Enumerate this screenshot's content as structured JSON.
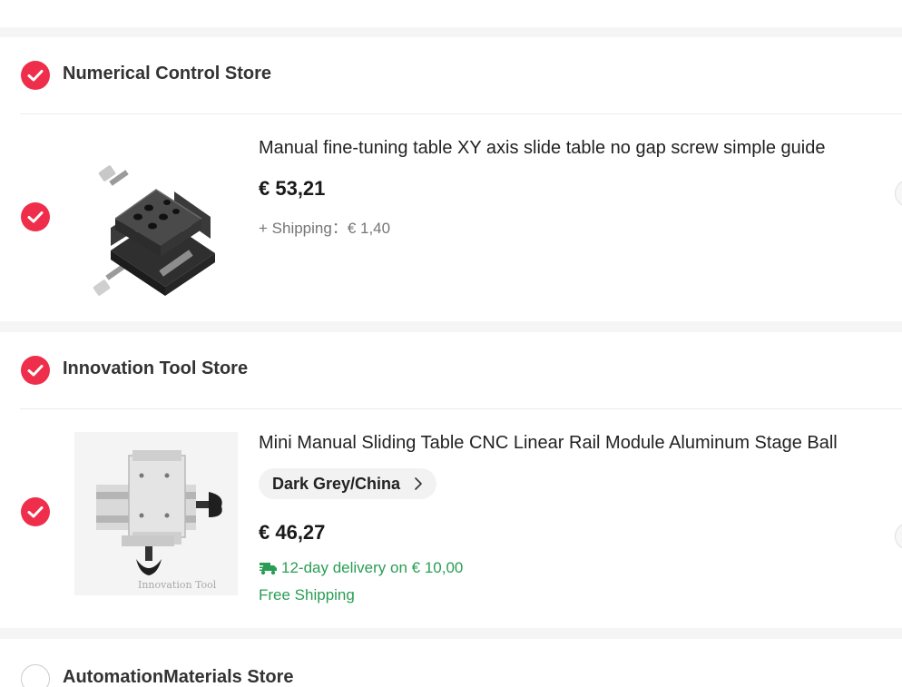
{
  "stores": [
    {
      "name": "Numerical Control Store",
      "checked": true,
      "item": {
        "title": "Manual fine-tuning table XY axis slide table no gap screw simple guide",
        "price": "€ 53,21",
        "shipping": "+ Shipping：€ 1,40"
      }
    },
    {
      "name": "Innovation Tool Store",
      "checked": true,
      "item": {
        "title": "Mini Manual Sliding Table CNC Linear Rail Module Aluminum Stage Ball",
        "variant": "Dark Grey/China",
        "price": "€ 46,27",
        "delivery": "12-day delivery on € 10,00",
        "free_shipping": "Free Shipping",
        "image_watermark": "Innovation Tool"
      }
    },
    {
      "name": "AutomationMaterials Store",
      "checked": false
    }
  ],
  "colors": {
    "accent": "#ee2e4a",
    "delivery_green": "#2a9d54",
    "text_primary": "#222222",
    "text_muted": "#757575"
  },
  "icons": [
    "check-icon",
    "chevron-right-icon",
    "truck-icon"
  ]
}
